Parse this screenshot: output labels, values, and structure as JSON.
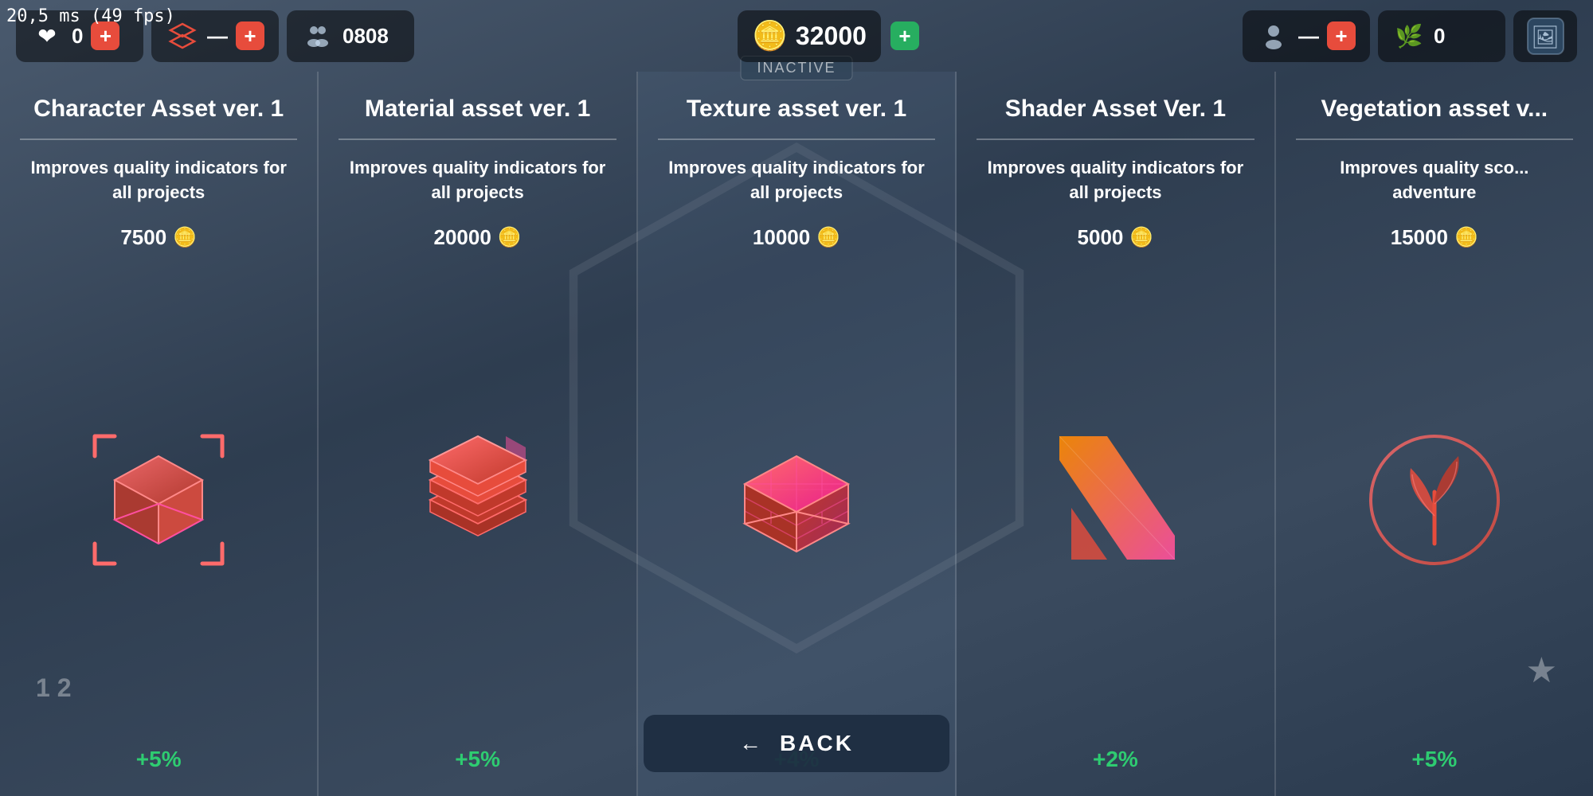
{
  "fps": "20,5 ms (49 fps)",
  "topbar": {
    "slot1": {
      "icon": "❤",
      "value": "0",
      "plus": "+",
      "plusColor": "red"
    },
    "slot2": {
      "icon": "🗂",
      "value": "—",
      "plus": "+",
      "plusColor": "red"
    },
    "slot3": {
      "icon": "👥",
      "value": "0808",
      "plus": null
    },
    "coin": {
      "value": "32000"
    },
    "plus_coin": "+",
    "slot4": {
      "icon": "👤",
      "value": "—",
      "plus": "+",
      "plusColor": "red"
    },
    "slot5": {
      "icon": "🌿",
      "value": "0",
      "plus": null
    },
    "profile": "🖼"
  },
  "inactive_label": "INACTIVE",
  "cards": [
    {
      "id": "character-asset",
      "title": "Character Asset ver. 1",
      "description": "Improves quality indicators for all projects",
      "cost": "7500",
      "bonus": "+5%",
      "icon_type": "cube"
    },
    {
      "id": "material-asset",
      "title": "Material asset ver. 1",
      "description": "Improves quality indicators for all projects",
      "cost": "20000",
      "bonus": "+5%",
      "icon_type": "layers"
    },
    {
      "id": "texture-asset",
      "title": "Texture asset ver. 1",
      "description": "Improves quality indicators for all projects",
      "cost": "10000",
      "bonus": "+4%",
      "icon_type": "bricks",
      "active": true
    },
    {
      "id": "shader-asset",
      "title": "Shader Asset Ver. 1",
      "description": "Improves quality indicators for all projects",
      "cost": "5000",
      "bonus": "+2%",
      "icon_type": "shader"
    },
    {
      "id": "vegetation-asset",
      "title": "Vegetation asset v...",
      "description": "Improves quality sco... adventure",
      "cost": "15000",
      "bonus": "+5%",
      "icon_type": "plant"
    }
  ],
  "back_button": {
    "label": "BACK",
    "arrow": "←"
  }
}
